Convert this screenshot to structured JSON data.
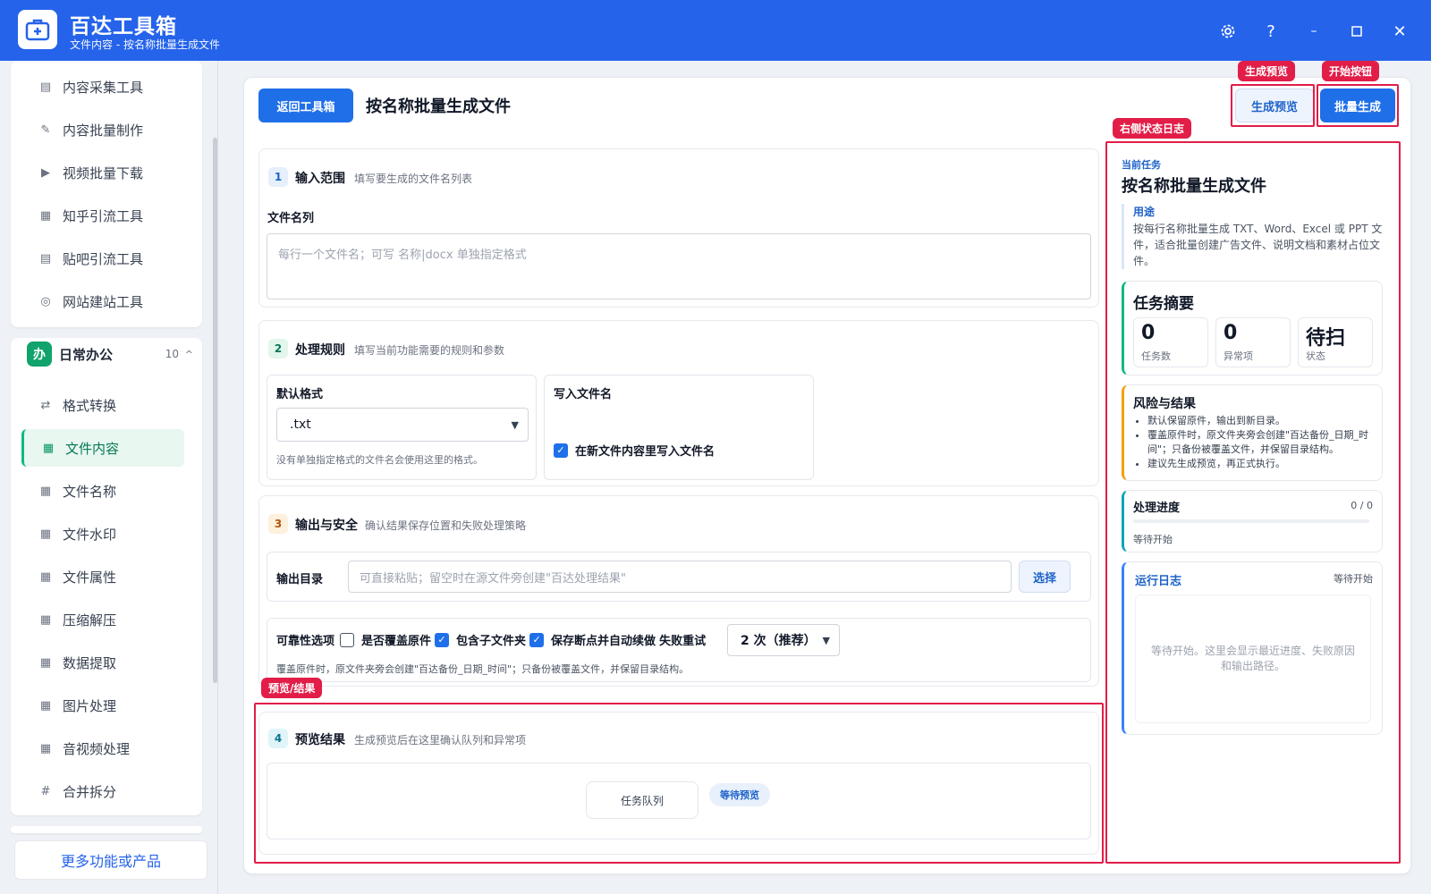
{
  "app": {
    "name": "百达工具箱",
    "subtitle": "文件内容 - 按名称批量生成文件"
  },
  "sidebar": {
    "top_items": [
      {
        "label": "内容采集工具",
        "icon": "document-icon"
      },
      {
        "label": "内容批量制作",
        "icon": "pen-icon"
      },
      {
        "label": "视频批量下载",
        "icon": "video-icon"
      },
      {
        "label": "知乎引流工具",
        "icon": "zhihu-icon"
      },
      {
        "label": "贴吧引流工具",
        "icon": "tieba-icon"
      },
      {
        "label": "网站建站工具",
        "icon": "globe-icon"
      }
    ],
    "group": {
      "badge": "办",
      "title": "日常办公",
      "count": "10",
      "caret": "^"
    },
    "group_items": [
      {
        "label": "格式转换",
        "icon": "convert-icon"
      },
      {
        "label": "文件内容",
        "icon": "grid-icon",
        "active": true
      },
      {
        "label": "文件名称",
        "icon": "grid-icon"
      },
      {
        "label": "文件水印",
        "icon": "grid-icon"
      },
      {
        "label": "文件属性",
        "icon": "grid-icon"
      },
      {
        "label": "压缩解压",
        "icon": "grid-icon"
      },
      {
        "label": "数据提取",
        "icon": "grid-icon"
      },
      {
        "label": "图片处理",
        "icon": "grid-icon"
      },
      {
        "label": "音视频处理",
        "icon": "grid-icon"
      },
      {
        "label": "合并拆分",
        "icon": "hash-icon"
      }
    ],
    "more": "更多功能或产品"
  },
  "header": {
    "back": "返回工具箱",
    "title": "按名称批量生成文件",
    "preview_btn": "生成预览",
    "start_btn": "批量生成"
  },
  "annotations": {
    "preview": "生成预览",
    "start": "开始按钮",
    "log": "右侧状态日志",
    "result": "预览/结果"
  },
  "section1": {
    "num": "1",
    "title": "输入范围",
    "subtitle": "填写要生成的文件名列表",
    "field_label": "文件名列",
    "placeholder": "每行一个文件名；可写 名称|docx 单独指定格式"
  },
  "section2": {
    "num": "2",
    "title": "处理规则",
    "subtitle": "填写当前功能需要的规则和参数",
    "format_label": "默认格式",
    "format_value": ".txt",
    "format_help": "没有单独指定格式的文件名会使用这里的格式。",
    "write_label": "写入文件名",
    "write_checkbox": "在新文件内容里写入文件名"
  },
  "section3": {
    "num": "3",
    "title": "输出与安全",
    "subtitle": "确认结果保存位置和失败处理策略",
    "output_label": "输出目录",
    "output_placeholder": "可直接粘贴；留空时在源文件旁创建\"百达处理结果\"",
    "choose_btn": "选择",
    "reliability_label": "可靠性选项",
    "overwrite": "是否覆盖原件",
    "subfolders": "包含子文件夹",
    "resume": "保存断点并自动续做",
    "retry_label": "失败重试",
    "retry_value": "2 次（推荐）",
    "note": "覆盖原件时，原文件夹旁会创建\"百达备份_日期_时间\"；只备份被覆盖文件，并保留目录结构。"
  },
  "section4": {
    "num": "4",
    "title": "预览结果",
    "subtitle": "生成预览后在这里确认队列和异常项",
    "queue_label": "任务队列",
    "status_badge": "等待预览"
  },
  "right": {
    "current_label": "当前任务",
    "current_title": "按名称批量生成文件",
    "purpose_label": "用途",
    "purpose_text": "按每行名称批量生成 TXT、Word、Excel 或 PPT 文件，适合批量创建广告文件、说明文档和素材占位文件。",
    "summary_title": "任务摘要",
    "stats": [
      {
        "value": "0",
        "label": "任务数"
      },
      {
        "value": "0",
        "label": "异常项"
      },
      {
        "value": "待扫",
        "label": "状态"
      }
    ],
    "risk_title": "风险与结果",
    "risk_items": [
      "默认保留原件，输出到新目录。",
      "覆盖原件时，原文件夹旁会创建\"百达备份_日期_时间\"；只备份被覆盖文件，并保留目录结构。",
      "建议先生成预览，再正式执行。"
    ],
    "progress_title": "处理进度",
    "progress_count": "0 / 0",
    "progress_value": 0,
    "progress_status": "等待开始",
    "log_title": "运行日志",
    "log_status": "等待开始",
    "log_empty": "等待开始。这里会显示最近进度、失败原因和输出路径。"
  },
  "colors": {
    "brand": "#2563eb",
    "annotation": "#e11d48",
    "active": "#10b981"
  }
}
